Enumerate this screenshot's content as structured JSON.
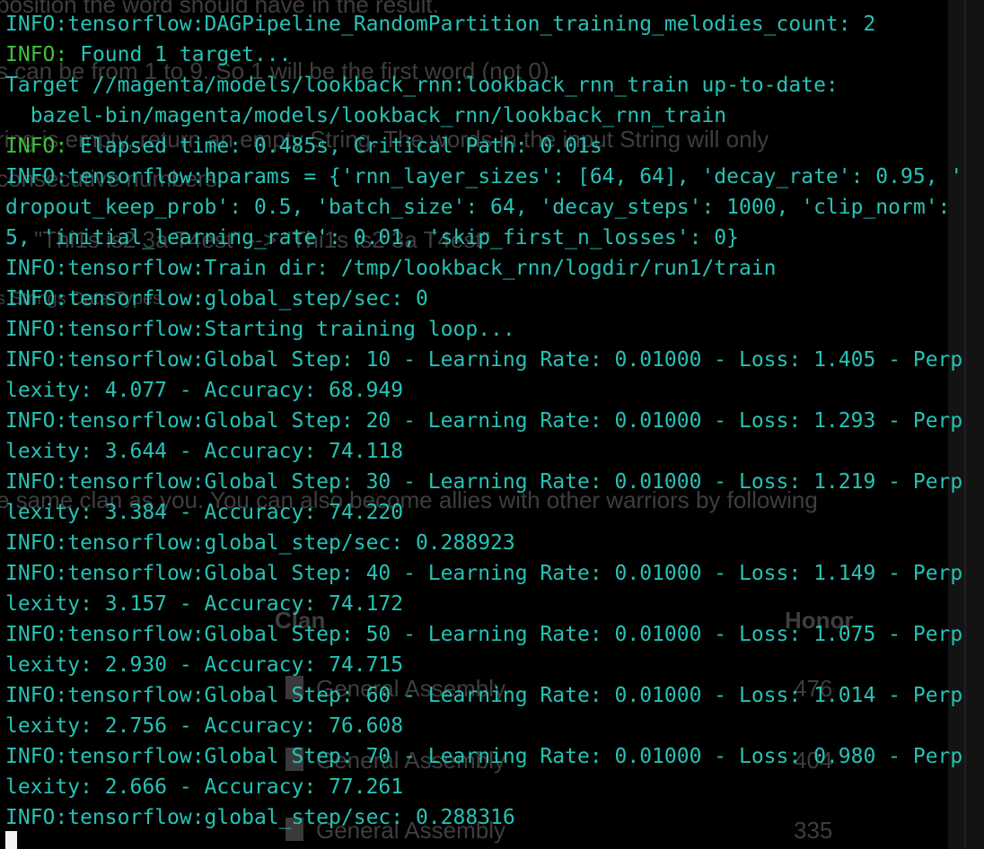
{
  "background": {
    "l1": "position the word should have in the result.",
    "l2": "s can be from 1 to 9. So 1 will be the first word (not 0).",
    "l3": "ring is empty, return an empty String. The words in the input String will only",
    "l4": "consecutive numbers.",
    "l5": "\"Thi1s is2 3a T4est\"  -->  \"Thi1s is2 3a T4est\"",
    "l6": "s  Strings  Data Types",
    "l7": "e same clan as you. You can also become allies with other warriors by following",
    "clan_header": "Clan",
    "honor_header": "Honor",
    "rows": [
      {
        "clan": "General Assembly",
        "honor": "476"
      },
      {
        "clan": "General Assembly",
        "honor": "404"
      },
      {
        "clan": "General Assembly",
        "honor": "335"
      }
    ]
  },
  "terminal": {
    "lines": [
      {
        "prefix": "",
        "text": "INFO:tensorflow:DAGPipeline_RandomPartition_training_melodies_count: 2"
      },
      {
        "prefix": "INFO:",
        "text": " Found 1 target..."
      },
      {
        "prefix": "",
        "text": "Target //magenta/models/lookback_rnn:lookback_rnn_train up-to-date:"
      },
      {
        "prefix": "",
        "text": "  bazel-bin/magenta/models/lookback_rnn/lookback_rnn_train"
      },
      {
        "prefix": "INFO:",
        "text": " Elapsed time: 0.485s, Critical Path: 0.01s"
      },
      {
        "prefix": "",
        "text": "INFO:tensorflow:hparams = {'rnn_layer_sizes': [64, 64], 'decay_rate': 0.95, '"
      },
      {
        "prefix": "",
        "text": "dropout_keep_prob': 0.5, 'batch_size': 64, 'decay_steps': 1000, 'clip_norm':"
      },
      {
        "prefix": "",
        "text": "5, 'initial_learning_rate': 0.01, 'skip_first_n_losses': 0}"
      },
      {
        "prefix": "",
        "text": "INFO:tensorflow:Train dir: /tmp/lookback_rnn/logdir/run1/train"
      },
      {
        "prefix": "",
        "text": "INFO:tensorflow:global_step/sec: 0"
      },
      {
        "prefix": "",
        "text": "INFO:tensorflow:Starting training loop..."
      },
      {
        "prefix": "",
        "text": "INFO:tensorflow:Global Step: 10 - Learning Rate: 0.01000 - Loss: 1.405 - Perp"
      },
      {
        "prefix": "",
        "text": "lexity: 4.077 - Accuracy: 68.949"
      },
      {
        "prefix": "",
        "text": "INFO:tensorflow:Global Step: 20 - Learning Rate: 0.01000 - Loss: 1.293 - Perp"
      },
      {
        "prefix": "",
        "text": "lexity: 3.644 - Accuracy: 74.118"
      },
      {
        "prefix": "",
        "text": "INFO:tensorflow:Global Step: 30 - Learning Rate: 0.01000 - Loss: 1.219 - Perp"
      },
      {
        "prefix": "",
        "text": "lexity: 3.384 - Accuracy: 74.220"
      },
      {
        "prefix": "",
        "text": "INFO:tensorflow:global_step/sec: 0.288923"
      },
      {
        "prefix": "",
        "text": "INFO:tensorflow:Global Step: 40 - Learning Rate: 0.01000 - Loss: 1.149 - Perp"
      },
      {
        "prefix": "",
        "text": "lexity: 3.157 - Accuracy: 74.172"
      },
      {
        "prefix": "",
        "text": "INFO:tensorflow:Global Step: 50 - Learning Rate: 0.01000 - Loss: 1.075 - Perp"
      },
      {
        "prefix": "",
        "text": "lexity: 2.930 - Accuracy: 74.715"
      },
      {
        "prefix": "",
        "text": "INFO:tensorflow:Global Step: 60 - Learning Rate: 0.01000 - Loss: 1.014 - Perp"
      },
      {
        "prefix": "",
        "text": "lexity: 2.756 - Accuracy: 76.608"
      },
      {
        "prefix": "",
        "text": "INFO:tensorflow:Global Step: 70 - Learning Rate: 0.01000 - Loss: 0.980 - Perp"
      },
      {
        "prefix": "",
        "text": "lexity: 2.666 - Accuracy: 77.261"
      },
      {
        "prefix": "",
        "text": "INFO:tensorflow:global_step/sec: 0.288316"
      }
    ]
  },
  "colors": {
    "background": "#000000",
    "output_text": "#27c2b5",
    "info_prefix": "#3fc13a",
    "cursor": "#f2f2f2"
  }
}
